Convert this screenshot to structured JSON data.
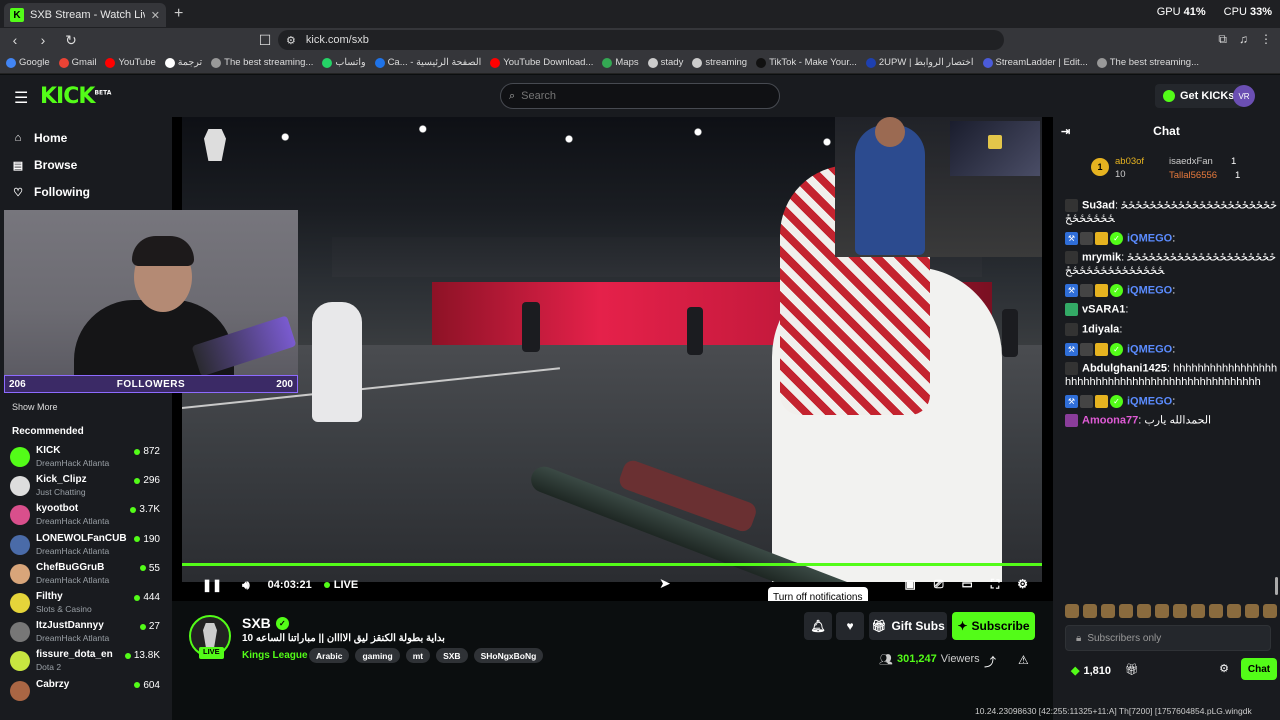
{
  "browser": {
    "tab_title": "SXB Stream - Watch Live on K",
    "gpu_label": "GPU",
    "gpu_value": "41%",
    "cpu_label": "CPU",
    "cpu_value": "33%",
    "url": "kick.com/sxb",
    "bookmarks": [
      "Google",
      "Gmail",
      "YouTube",
      "ترجمة",
      "The best streaming...",
      "واتساب",
      "Ca... - الصفحة الرئيسية",
      "YouTube Download...",
      "Maps",
      "stady",
      "streaming",
      "TikTok - Make Your...",
      "2UPW | اختصار الروابط",
      "StreamLadder | Edit...",
      "The best streaming..."
    ]
  },
  "header": {
    "logo": "KICK",
    "logo_tag": "BETA",
    "search_placeholder": "Search",
    "get_kicks": "Get KICKs",
    "avatar_initials": "VR"
  },
  "sidebar": {
    "nav": [
      {
        "icon": "home-icon",
        "glyph": "⌂",
        "label": "Home"
      },
      {
        "icon": "browse-icon",
        "glyph": "▤",
        "label": "Browse"
      },
      {
        "icon": "heart-icon",
        "glyph": "♡",
        "label": "Following"
      }
    ],
    "show_more": "Show More",
    "recommended_label": "Recommended",
    "recommended": [
      {
        "name": "KICK",
        "sub": "DreamHack Atlanta",
        "viewers": "872",
        "color": "#53fc18"
      },
      {
        "name": "Kick_Clipz",
        "sub": "Just Chatting",
        "viewers": "296",
        "color": "#ddd"
      },
      {
        "name": "kyootbot",
        "sub": "DreamHack Atlanta",
        "viewers": "3.7K",
        "color": "#d94f8c"
      },
      {
        "name": "LONEWOLFanCUB",
        "sub": "DreamHack Atlanta",
        "viewers": "190",
        "color": "#4a6ba8"
      },
      {
        "name": "ChefBuGGruB",
        "sub": "DreamHack Atlanta",
        "viewers": "55",
        "color": "#d8a57a"
      },
      {
        "name": "Filthy",
        "sub": "Slots & Casino",
        "viewers": "444",
        "color": "#e5d43a"
      },
      {
        "name": "ItzJustDannyy",
        "sub": "DreamHack Atlanta",
        "viewers": "27",
        "color": "#777"
      },
      {
        "name": "fissure_dota_en",
        "sub": "Dota 2",
        "viewers": "13.8K",
        "color": "#c8e640"
      },
      {
        "name": "Cabrzy",
        "sub": "",
        "viewers": "604",
        "color": "#aa6644"
      }
    ]
  },
  "webcam": {
    "followers_left": "206",
    "followers_label": "FOLLOWERS",
    "followers_right": "200"
  },
  "player": {
    "progress": 1.0,
    "time": "04:03:21",
    "live_label": "LIVE",
    "tooltip": "Turn off notifications"
  },
  "channel": {
    "name": "SXB",
    "live_badge": "LIVE",
    "title": "بداية بطولة الكنقز ليق الاااان || مباراتنا الساعه 10",
    "category": "Kings League",
    "tags": [
      "Arabic",
      "gaming",
      "mt",
      "SXB",
      "SHoNgxBoNg"
    ],
    "gift_subs": "Gift Subs",
    "subscribe": "Subscribe",
    "viewers": "301,247",
    "viewers_label": "Viewers"
  },
  "chat": {
    "title": "Chat",
    "top_gifter": "ab03of",
    "top_gifter_count": "10",
    "top_gifter_rank": "1",
    "gifter2": "isaedxFan",
    "gifter2_count": "1",
    "gifter3": "Tallal56556",
    "gifter3_count": "1",
    "messages": [
      {
        "user": "Su3ad",
        "color": "#ffffff",
        "text": "ځځځځځځځځځځځځځځځځځځځځځځځځځځځځځ"
      },
      {
        "user": "iQMEGO",
        "color": "#5b8cff",
        "text": ""
      },
      {
        "user": "mrymik",
        "color": "#ffffff",
        "text": "ځځځځځځځځځځځځځځځځځځځځځځځځځځځځځځځځځځځ"
      },
      {
        "user": "iQMEGO",
        "color": "#5b8cff",
        "text": ""
      },
      {
        "user": "vSARA1",
        "color": "#ffffff",
        "text": ""
      },
      {
        "user": "1diyala",
        "color": "#ffffff",
        "text": ""
      },
      {
        "user": "iQMEGO",
        "color": "#5b8cff",
        "text": ""
      },
      {
        "user": "Abdulghani1425",
        "color": "#ffffff",
        "text": "hhhhhhhhhhhhhhhhhhhhhhhhhhhhhhhhhhhhhhhhhhhhhhhhh"
      },
      {
        "user": "iQMEGO",
        "color": "#5b8cff",
        "text": ""
      },
      {
        "user": "Amoona77",
        "color": "#e05bd6",
        "text": "الحمدالله يارب"
      }
    ],
    "subscribers_only": "Subscribers only",
    "points": "1,810",
    "chat_button": "Chat"
  },
  "debug_text": "10.24.23098630 [42:255:11325+11:A] Th[7200] [1757604854.pLG.wingdk"
}
